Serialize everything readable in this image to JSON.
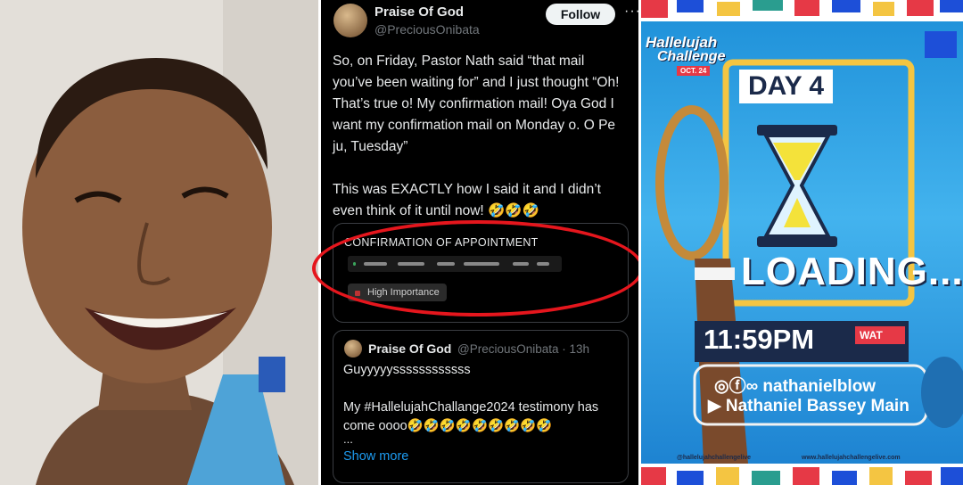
{
  "tweet": {
    "author_name": "Praise Of God",
    "author_handle": "@PreciousOnibata",
    "follow_label": "Follow",
    "more_label": "···",
    "body": "So, on Friday, Pastor Nath said “that mail you’ve been waiting for” and I just thought “Oh! That’s true o! My confirmation mail! Oya God I want my confirmation mail on Monday o. O Pe ju, Tuesday”\n\nThis was EXACTLY how I said it and I didn’t even think of it until now! 🤣🤣🤣",
    "mail": {
      "title": "CONFIRMATION OF APPOINTMENT",
      "importance": "High Importance"
    },
    "quoted": {
      "author_name": "Praise Of God",
      "author_handle": "@PreciousOnibata · 13h",
      "line1": "Guyyyyyssssssssssss",
      "line2": "My #HallelujahChallange2024 testimony has come oooo🤣🤣🤣🤣🤣🤣🤣🤣🤣",
      "ellipsis": "...",
      "show_more": "Show more"
    }
  },
  "poster": {
    "logo_line1": "Hallelujah",
    "logo_line2": "Challenge",
    "logo_date": "OCT. 24",
    "day": "DAY 4",
    "loading": "LOADING...",
    "time": "11:59PM",
    "tz": "WAT",
    "social1": "nathanielblow",
    "social2": "Nathaniel Bassey Main",
    "footer1": "@hallelujahchallengelive",
    "footer2": "www.hallelujahchallengelive.com"
  }
}
